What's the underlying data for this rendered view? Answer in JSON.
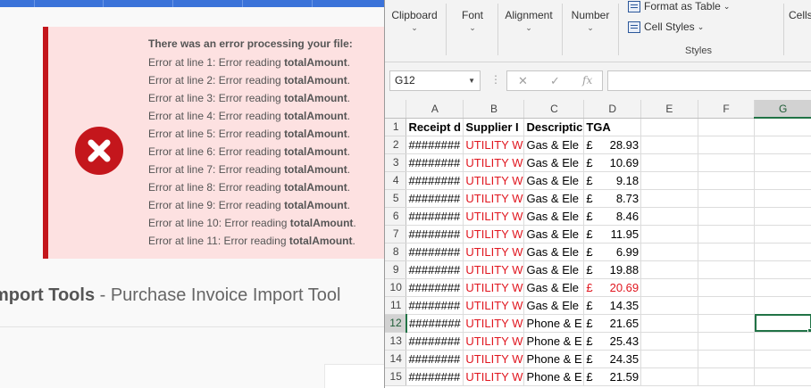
{
  "web": {
    "error": {
      "title": "There was an error processing your file:",
      "lines": [
        {
          "prefix": "Error at line 1: Error reading ",
          "field": "totalAmount",
          "suffix": "."
        },
        {
          "prefix": "Error at line 2: Error reading ",
          "field": "totalAmount",
          "suffix": "."
        },
        {
          "prefix": "Error at line 3: Error reading ",
          "field": "totalAmount",
          "suffix": "."
        },
        {
          "prefix": "Error at line 4: Error reading ",
          "field": "totalAmount",
          "suffix": "."
        },
        {
          "prefix": "Error at line 5: Error reading ",
          "field": "totalAmount",
          "suffix": "."
        },
        {
          "prefix": "Error at line 6: Error reading ",
          "field": "totalAmount",
          "suffix": "."
        },
        {
          "prefix": "Error at line 7: Error reading ",
          "field": "totalAmount",
          "suffix": "."
        },
        {
          "prefix": "Error at line 8: Error reading ",
          "field": "totalAmount",
          "suffix": "."
        },
        {
          "prefix": "Error at line 9: Error reading ",
          "field": "totalAmount",
          "suffix": "."
        },
        {
          "prefix": "Error at line 10: Error reading ",
          "field": "totalAmount",
          "suffix": "."
        },
        {
          "prefix": "Error at line 11: Error reading ",
          "field": "totalAmount",
          "suffix": "."
        }
      ]
    },
    "heading": {
      "section": "mport Tools",
      "separator": " - ",
      "title": "Purchase Invoice Import Tool"
    }
  },
  "excel": {
    "ribbon": {
      "groups": [
        "Clipboard",
        "Font",
        "Alignment",
        "Number"
      ],
      "styles": {
        "format_as_table": "Format as Table",
        "cell_styles": "Cell Styles",
        "label": "Styles"
      },
      "cells_label": "Cells"
    },
    "namebox": "G12",
    "formula_icons": {
      "cancel": "✕",
      "enter": "✓",
      "function": "fx"
    },
    "columns": [
      "A",
      "B",
      "C",
      "D",
      "E",
      "F",
      "G"
    ],
    "selected_column": "G",
    "selected_row": "12",
    "header_row": {
      "A": "Receipt d",
      "B": "Supplier I",
      "C": "Descriptic",
      "D": "TGA"
    },
    "rows": [
      {
        "n": "2",
        "a": "########",
        "b": "UTILITY W",
        "c": "Gas & Ele",
        "cur": "£",
        "amt": "28.93",
        "red_amt": false
      },
      {
        "n": "3",
        "a": "########",
        "b": "UTILITY W",
        "c": "Gas & Ele",
        "cur": "£",
        "amt": "10.69",
        "red_amt": false
      },
      {
        "n": "4",
        "a": "########",
        "b": "UTILITY W",
        "c": "Gas & Ele",
        "cur": "£",
        "amt": "9.18",
        "red_amt": false
      },
      {
        "n": "5",
        "a": "########",
        "b": "UTILITY W",
        "c": "Gas & Ele",
        "cur": "£",
        "amt": "8.73",
        "red_amt": false
      },
      {
        "n": "6",
        "a": "########",
        "b": "UTILITY W",
        "c": "Gas & Ele",
        "cur": "£",
        "amt": "8.46",
        "red_amt": false
      },
      {
        "n": "7",
        "a": "########",
        "b": "UTILITY W",
        "c": "Gas & Ele",
        "cur": "£",
        "amt": "11.95",
        "red_amt": false
      },
      {
        "n": "8",
        "a": "########",
        "b": "UTILITY W",
        "c": "Gas & Ele",
        "cur": "£",
        "amt": "6.99",
        "red_amt": false
      },
      {
        "n": "9",
        "a": "########",
        "b": "UTILITY W",
        "c": "Gas & Ele",
        "cur": "£",
        "amt": "19.88",
        "red_amt": false
      },
      {
        "n": "10",
        "a": "########",
        "b": "UTILITY W",
        "c": "Gas & Ele",
        "cur": "£",
        "amt": "20.69",
        "red_amt": true
      },
      {
        "n": "11",
        "a": "########",
        "b": "UTILITY W",
        "c": "Gas & Ele",
        "cur": "£",
        "amt": "14.35",
        "red_amt": false
      },
      {
        "n": "12",
        "a": "########",
        "b": "UTILITY W",
        "c": "Phone & E",
        "cur": "£",
        "amt": "21.65",
        "red_amt": false
      },
      {
        "n": "13",
        "a": "########",
        "b": "UTILITY W",
        "c": "Phone & E",
        "cur": "£",
        "amt": "25.43",
        "red_amt": false
      },
      {
        "n": "14",
        "a": "########",
        "b": "UTILITY W",
        "c": "Phone & E",
        "cur": "£",
        "amt": "24.35",
        "red_amt": false
      },
      {
        "n": "15",
        "a": "########",
        "b": "UTILITY W",
        "c": "Phone & E",
        "cur": "£",
        "amt": "21.59",
        "red_amt": false
      }
    ],
    "colors": {
      "excel_green": "#217346",
      "error_red": "#c4161c",
      "cell_red": "#e0161f"
    }
  }
}
